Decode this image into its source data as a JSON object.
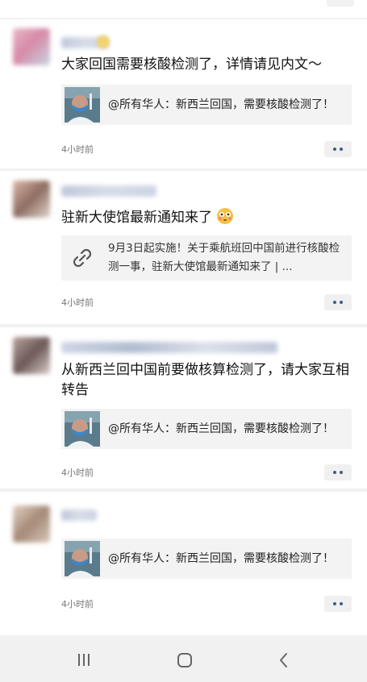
{
  "posts": [
    {
      "text": "大家回国需要核酸检测了，详情请见内文～",
      "card_title": "@所有华人：新西兰回国，需要核酸检测了！",
      "time": "4小时前"
    },
    {
      "text": "驻新大使馆最新通知来了",
      "link_text": "9月3日起实施！关于乘航班回中国前进行核酸检测一事，驻新大使馆最新通知来了 | ...",
      "time": "4小时前"
    },
    {
      "text": "从新西兰回中国前要做核算检测了，请大家互相转告",
      "card_title": "@所有华人：新西兰回国，需要核酸检测了！",
      "time": "4小时前"
    },
    {
      "card_title": "@所有华人：新西兰回国，需要核酸检测了！",
      "time": "4小时前"
    }
  ],
  "emoji": {
    "flushed": "flushed-face-emoji"
  },
  "icons": {
    "link": "link-icon",
    "more": "more-dots-icon",
    "recents": "recent-apps-icon",
    "home": "home-icon",
    "back": "back-icon"
  },
  "colors": {
    "more_dots": "#445b80",
    "background": "#f1f1f1"
  }
}
